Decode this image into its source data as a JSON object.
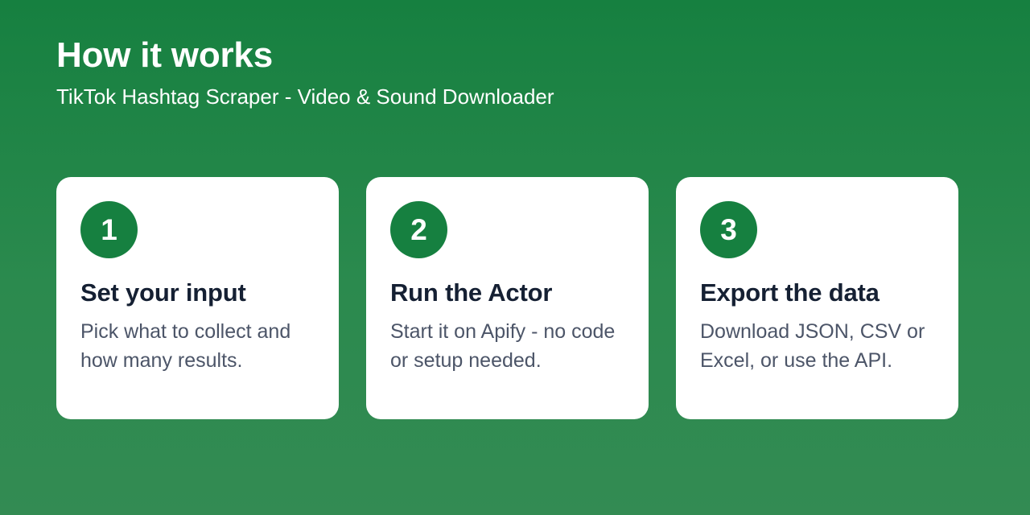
{
  "header": {
    "title": "How it works",
    "subtitle": "TikTok Hashtag Scraper - Video & Sound Downloader"
  },
  "colors": {
    "accent_green": "#168040",
    "background_top": "#168040",
    "background_bottom": "#338b53",
    "card_background": "#ffffff",
    "title_text": "#152033",
    "description_text": "#4c5568"
  },
  "steps": [
    {
      "number": "1",
      "title": "Set your input",
      "description": "Pick what to collect and how many results."
    },
    {
      "number": "2",
      "title": "Run the Actor",
      "description": "Start it on Apify - no code or setup needed."
    },
    {
      "number": "3",
      "title": "Export the data",
      "description": "Download JSON, CSV or Excel, or use the API."
    }
  ]
}
